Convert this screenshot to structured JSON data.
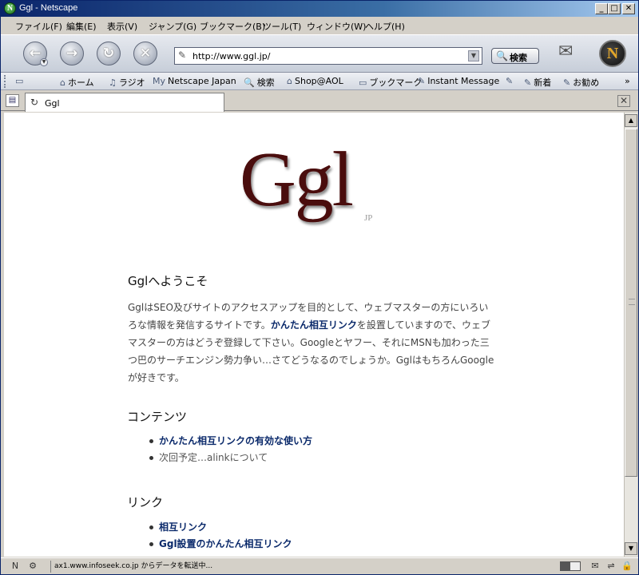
{
  "window": {
    "title": "Ggl - Netscape",
    "icon_glyph": "N",
    "min_glyph": "_",
    "max_glyph": "□",
    "close_glyph": "✕"
  },
  "menubar": {
    "items": [
      "ファイル(F)",
      "編集(E)",
      "表示(V)",
      "ジャンプ(G)",
      "ブックマーク(B)",
      "ツール(T)",
      "ウィンドウ(W)",
      "ヘルプ(H)"
    ]
  },
  "nav": {
    "back_glyph": "←",
    "forward_glyph": "→",
    "reload_glyph": "↻",
    "stop_glyph": "✕",
    "url": "http://www.ggl.jp/",
    "url_icon": "✎",
    "url_drop_glyph": "▼",
    "search_icon": "🔍",
    "search_label": "検索",
    "mail_glyph": "✉",
    "throbber_glyph": "N"
  },
  "personal_toolbar": {
    "items": [
      {
        "icon": "▭",
        "label": ""
      },
      {
        "icon": "⌂",
        "label": "ホーム"
      },
      {
        "icon": "♫",
        "label": "ラジオ"
      },
      {
        "icon": "My",
        "label": "Netscape Japan"
      },
      {
        "icon": "🔍",
        "label": "検索"
      },
      {
        "icon": "⌂",
        "label": "Shop@AOL"
      },
      {
        "icon": "▭",
        "label": "ブックマーク"
      },
      {
        "icon": "✎",
        "label": "Instant Message"
      },
      {
        "icon": "✎",
        "label": ""
      },
      {
        "icon": "✎",
        "label": "新着"
      },
      {
        "icon": "✎",
        "label": "お勧め"
      },
      {
        "icon": "»",
        "label": ""
      }
    ]
  },
  "tabs": {
    "new_tab_glyph": "▤",
    "active_tab": {
      "icon": "↻",
      "label": "Ggl"
    },
    "close_glyph": "✕"
  },
  "page": {
    "logo_text": "Ggl",
    "logo_sub": "JP",
    "welcome_heading": "Gglへようこそ",
    "welcome_text_1": "GglはSEO及びサイトのアクセスアップを目的として、ウェブマスターの方にいろいろな情報を発信するサイトです。",
    "welcome_link": "かんたん相互リンク",
    "welcome_text_2": "を設置していますので、ウェブマスターの方はどうぞ登録して下さい。Googleとヤフー、それにMSNも加わった三つ巴のサーチエンジン勢力争い…さてどうなるのでしょうか。GglはもちろんGoogleが好きです。",
    "contents_heading": "コンテンツ",
    "contents_items": [
      {
        "label": "かんたん相互リンクの有効な使い方",
        "type": "link"
      },
      {
        "label": "次回予定…alinkについて",
        "type": "plain"
      }
    ],
    "links_heading": "リンク",
    "links_items": [
      {
        "label": "相互リンク",
        "type": "link"
      },
      {
        "label": "Ggl設置のかんたん相互リンク",
        "type": "link"
      }
    ]
  },
  "scrollbar": {
    "up_glyph": "▲",
    "down_glyph": "▼"
  },
  "statusbar": {
    "text": "ax1.www.infoseek.co.jp からデータを転送中...",
    "icons": [
      "N",
      "⚙",
      "✉",
      "⇌",
      "🔒"
    ],
    "progress_fraction": 0.5
  },
  "colors": {
    "link": "#0b2a6b",
    "logo": "#4a0d0d",
    "titlebar_start": "#0a246a"
  }
}
